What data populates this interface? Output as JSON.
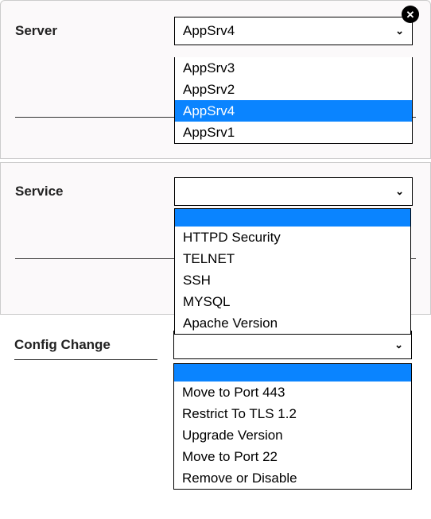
{
  "labels": {
    "server": "Server",
    "service": "Service",
    "config_change": "Config Change"
  },
  "server": {
    "selected": "AppSrv4",
    "options": [
      "AppSrv3",
      "AppSrv2",
      "AppSrv4",
      "AppSrv1"
    ],
    "highlight_index": 2
  },
  "service": {
    "selected": "",
    "options": [
      "HTTPD Security",
      "TELNET",
      "SSH",
      "MYSQL",
      "Apache Version"
    ],
    "blank_highlight": true
  },
  "config_change": {
    "selected": "",
    "options": [
      "Move to Port 443",
      "Restrict To TLS 1.2",
      "Upgrade Version",
      "Move to Port 22",
      "Remove or Disable"
    ],
    "blank_highlight": true
  }
}
